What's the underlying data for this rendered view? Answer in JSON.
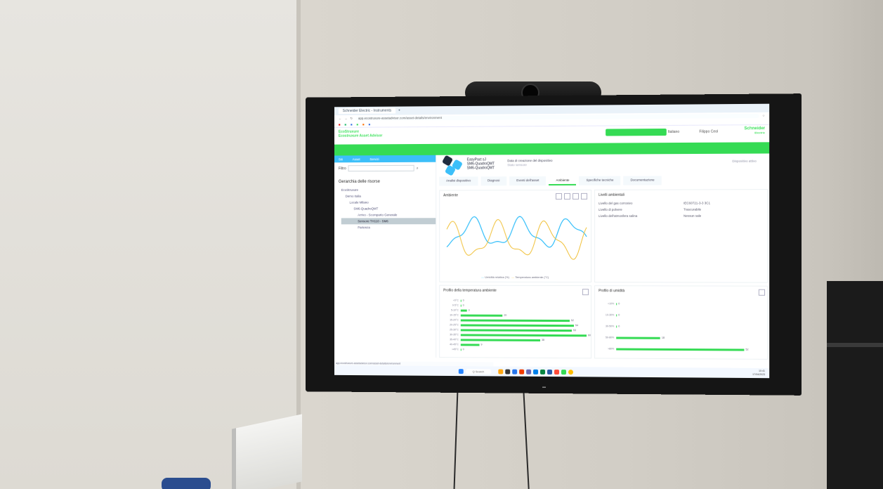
{
  "browser": {
    "tab_title": "Schneider Electric - Instruments",
    "url": "app.ecostruxure-assetadvisor.com/asset-details/environment"
  },
  "app": {
    "logo_line1": "EcoStruxure",
    "logo_line2": "Ecostruxure Asset Advisor",
    "language": "Italiano",
    "user": "Filippo Ceol",
    "brand_line1": "Schneider",
    "brand_line2": "Electric"
  },
  "sidebar": {
    "tabs": [
      "Siti",
      "Asset",
      "Servizi"
    ],
    "search_label": "Filtro",
    "title": "Gerarchia delle risorse",
    "tree": [
      {
        "label": "EcoStruxure",
        "selected": false,
        "indent": 0
      },
      {
        "label": "Demo Italia",
        "selected": false,
        "indent": 1
      },
      {
        "label": "Locale Milano",
        "selected": false,
        "indent": 2
      },
      {
        "label": "SM6-QuadroQMT",
        "selected": false,
        "indent": 3
      },
      {
        "label": "Arrivo - Scomparto Generale",
        "selected": false,
        "indent": 4
      },
      {
        "label": "Sensore TH110 - SM6",
        "selected": true,
        "indent": 4
      },
      {
        "label": "Partenza",
        "selected": false,
        "indent": 4
      }
    ]
  },
  "device": {
    "name_line1": "EasyPact sJ",
    "name_line2": "SM6-QuadroQMT",
    "name_line3": "SM6-QuadroQMT",
    "info_line1": "Data di creazione del dispositivo",
    "info_line2": "Stato sensore",
    "status": "Dispositivo attivo"
  },
  "tabs": [
    "Analisi dispositivo",
    "Diagnosi",
    "Eventi dell'asset",
    "Ambiente",
    "Specifiche tecniche",
    "Documentazione"
  ],
  "active_tab_index": 3,
  "ambient": {
    "chart_title": "Ambiente",
    "legend_humidity": "Umidità relativa (%)",
    "legend_temp": "Temperatura ambiente (°C)"
  },
  "levels": {
    "title": "Livelli ambientali",
    "rows": [
      {
        "key": "Livello del gas corrosivo",
        "value": "IEC60721-3-3 3C1"
      },
      {
        "key": "Livello di polvere",
        "value": "Trascurabile"
      },
      {
        "key": "Livello dell'atmosfera salina",
        "value": "Nessun sale"
      }
    ]
  },
  "temp_profile": {
    "title": "Profilo della temperatura ambiente",
    "bars": [
      {
        "label": "<0°C",
        "value": 0
      },
      {
        "label": "0-5°C",
        "value": 0
      },
      {
        "label": "5-10°C",
        "value": 3
      },
      {
        "label": "10-15°C",
        "value": 20
      },
      {
        "label": "15-20°C",
        "value": 52
      },
      {
        "label": "20-25°C",
        "value": 54
      },
      {
        "label": "25-30°C",
        "value": 53
      },
      {
        "label": "30-35°C",
        "value": 60
      },
      {
        "label": "35-40°C",
        "value": 38
      },
      {
        "label": "40-45°C",
        "value": 9
      },
      {
        "label": ">45°C",
        "value": 0
      }
    ]
  },
  "humidity_profile": {
    "title": "Profilo di umidità",
    "bars": [
      {
        "label": "<10%",
        "value": 0
      },
      {
        "label": "10-30%",
        "value": 0
      },
      {
        "label": "30-50%",
        "value": 0
      },
      {
        "label": "50-80%",
        "value": 18
      },
      {
        "label": ">80%",
        "value": 52
      }
    ]
  },
  "taskbar": {
    "search_label": "Q Search",
    "time": "10:41",
    "date": "17/04/2023"
  },
  "colors": {
    "accent_green": "#3dcd58",
    "humidity_line": "#42b4e6",
    "temp_line": "#e0b84a"
  }
}
